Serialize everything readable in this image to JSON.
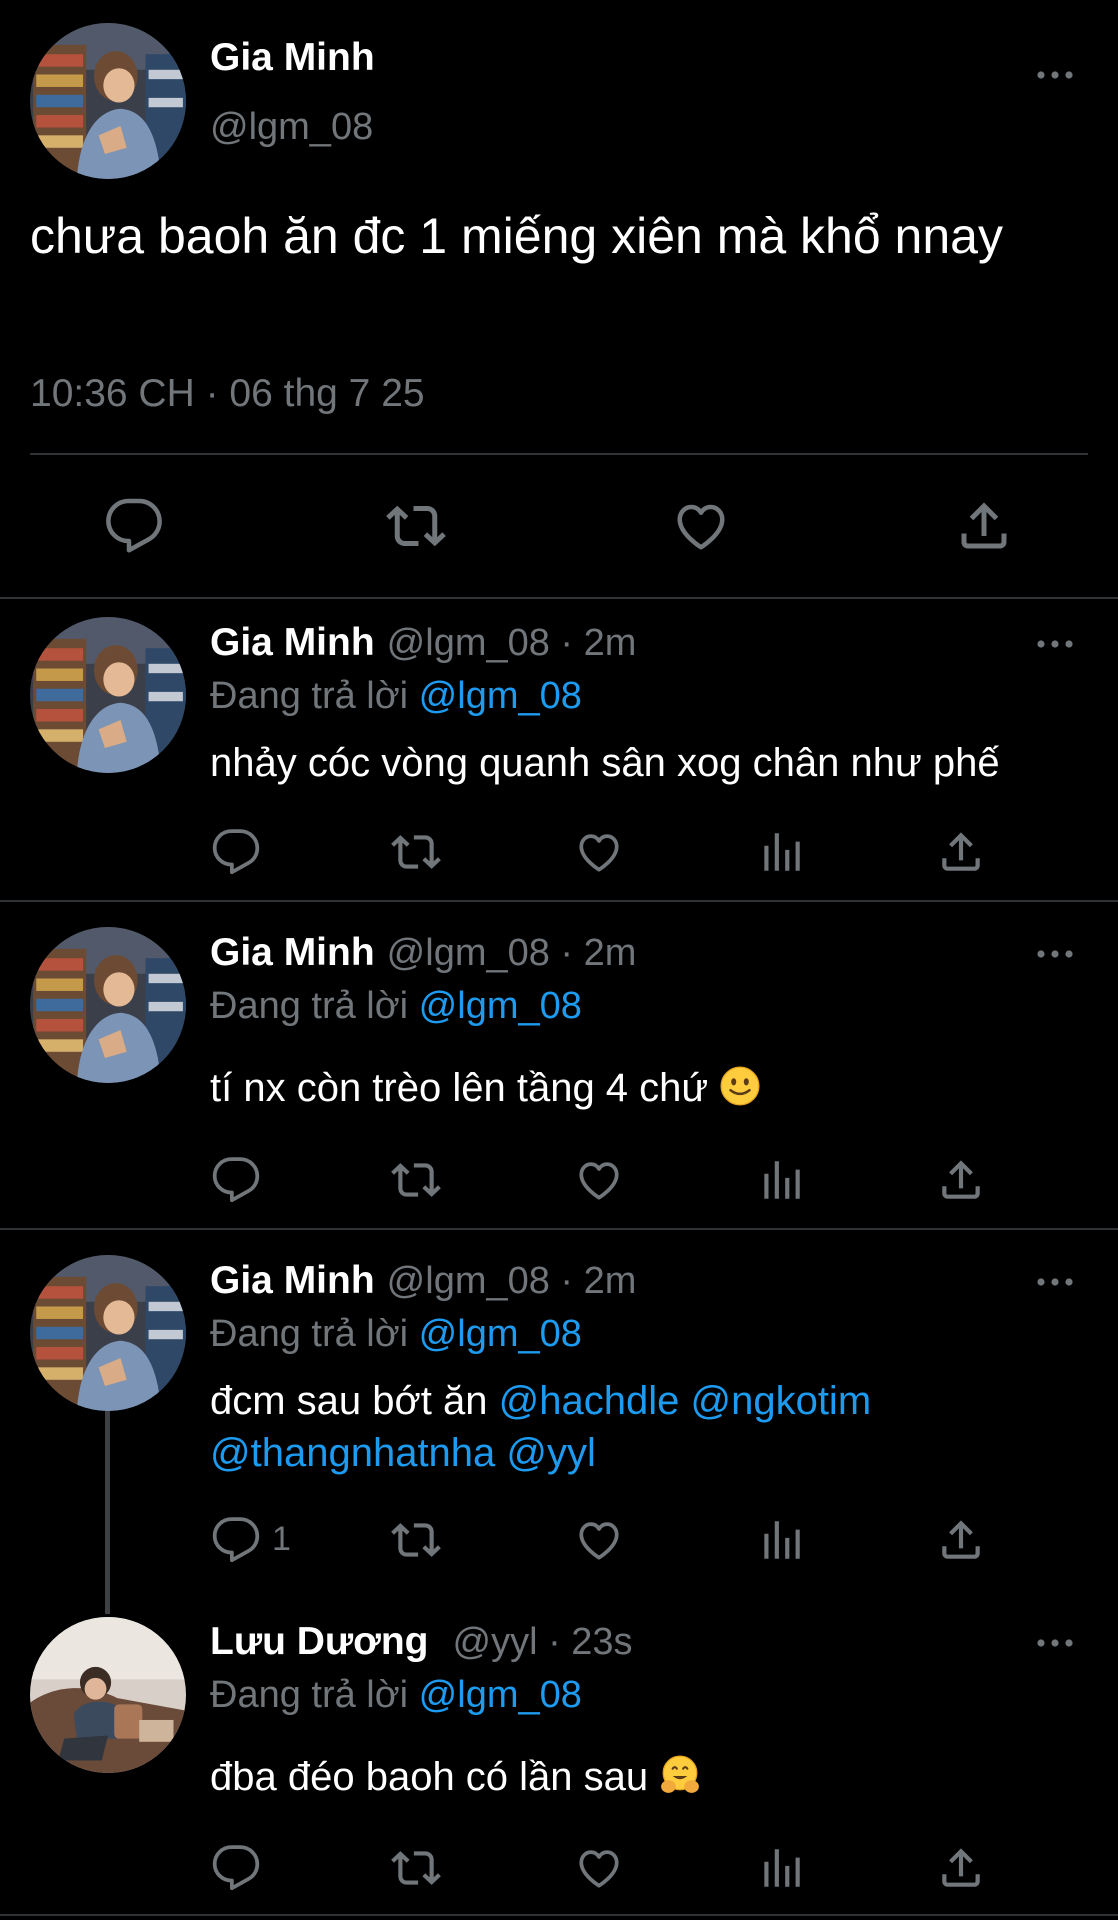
{
  "colors": {
    "background": "#000000",
    "text": "#e7e9ea",
    "muted": "#71767b",
    "link": "#1d9bf0",
    "divider": "#2f3336"
  },
  "main_tweet": {
    "author_name": "Gia Minh",
    "author_handle": "@lgm_08",
    "text": "chưa baoh ăn đc 1 miếng xiên mà khổ nnay",
    "timestamp": "10:36 CH · 06 thg 7 25",
    "actions": [
      "reply-icon",
      "retweet-icon",
      "like-icon",
      "share-icon"
    ]
  },
  "replies": [
    {
      "author_name": "Gia Minh",
      "meta": "@lgm_08 · 2m",
      "replying_label": "Đang trả lời",
      "replying_to": "@lgm_08",
      "text": "nhảy cóc vòng quanh sân xog chân như phế",
      "reply_count": ""
    },
    {
      "author_name": "Gia Minh",
      "meta": "@lgm_08 · 2m",
      "replying_label": "Đang trả lời",
      "replying_to": "@lgm_08",
      "text": "tí nx còn trèo lên tầng 4 chứ",
      "emoji": "slightly-smiling-face",
      "reply_count": ""
    },
    {
      "author_name": "Gia Minh",
      "meta": "@lgm_08 · 2m",
      "replying_label": "Đang trả lời",
      "replying_to": "@lgm_08",
      "text_prefix": "đcm sau bớt ăn",
      "mentions": [
        "@hachdle",
        "@ngkotim",
        "@thangnhatnha",
        "@yyl"
      ],
      "reply_count": "1"
    },
    {
      "author_name": "Lưu Dương",
      "meta": "@yyl · 23s",
      "replying_label": "Đang trả lời",
      "replying_to": "@lgm_08",
      "text": "đba đéo baoh có lần sau",
      "emoji": "hugging-face",
      "reply_count": ""
    }
  ]
}
